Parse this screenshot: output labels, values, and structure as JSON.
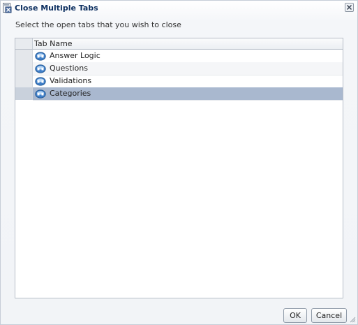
{
  "dialog": {
    "title": "Close Multiple Tabs",
    "instructions": "Select the open tabs that you wish to close"
  },
  "list": {
    "column_header": "Tab Name",
    "rows": [
      {
        "label": "Answer Logic",
        "icon": "tab-icon",
        "selected": false
      },
      {
        "label": "Questions",
        "icon": "tab-icon",
        "selected": false
      },
      {
        "label": "Validations",
        "icon": "tab-icon",
        "selected": false
      },
      {
        "label": "Categories",
        "icon": "tab-icon",
        "selected": true
      }
    ]
  },
  "buttons": {
    "ok_label": "OK",
    "cancel_label": "Cancel"
  },
  "colors": {
    "title_text": "#0b2e5f",
    "selected_row": "#a9b8cf",
    "panel_border": "#b7bec8"
  }
}
